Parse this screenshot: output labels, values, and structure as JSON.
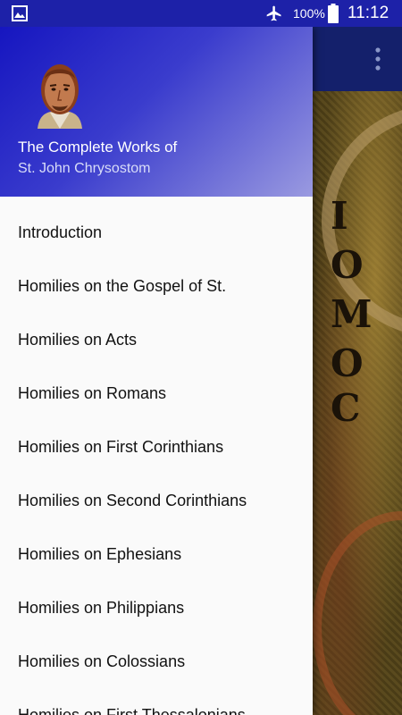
{
  "status_bar": {
    "battery_percent": "100%",
    "time": "11:12",
    "icons": [
      "image-notification-icon",
      "airplane-mode-icon",
      "battery-icon"
    ]
  },
  "background": {
    "app_bar_icon": "overflow-menu-icon",
    "image_letters": [
      "Ι",
      "Ο",
      "Μ",
      "Ο",
      "Ϲ"
    ]
  },
  "drawer": {
    "header": {
      "title": "The Complete Works of",
      "subtitle": "St. John Chrysostom",
      "avatar_icon": "saint-portrait-icon"
    },
    "items": [
      {
        "label": "Introduction"
      },
      {
        "label": "Homilies on the Gospel of St."
      },
      {
        "label": "Homilies on Acts"
      },
      {
        "label": "Homilies on Romans"
      },
      {
        "label": "Homilies on First Corinthians"
      },
      {
        "label": "Homilies on Second Corinthians"
      },
      {
        "label": "Homilies on Ephesians"
      },
      {
        "label": "Homilies on Philippians"
      },
      {
        "label": "Homilies on Colossians"
      },
      {
        "label": "Homilies on First Thessalonians"
      }
    ]
  },
  "colors": {
    "status_bar": "#1d21a8",
    "header_gradient_start": "#1616c0",
    "header_gradient_end": "#9a9ae0",
    "drawer_bg": "#fafafa"
  }
}
